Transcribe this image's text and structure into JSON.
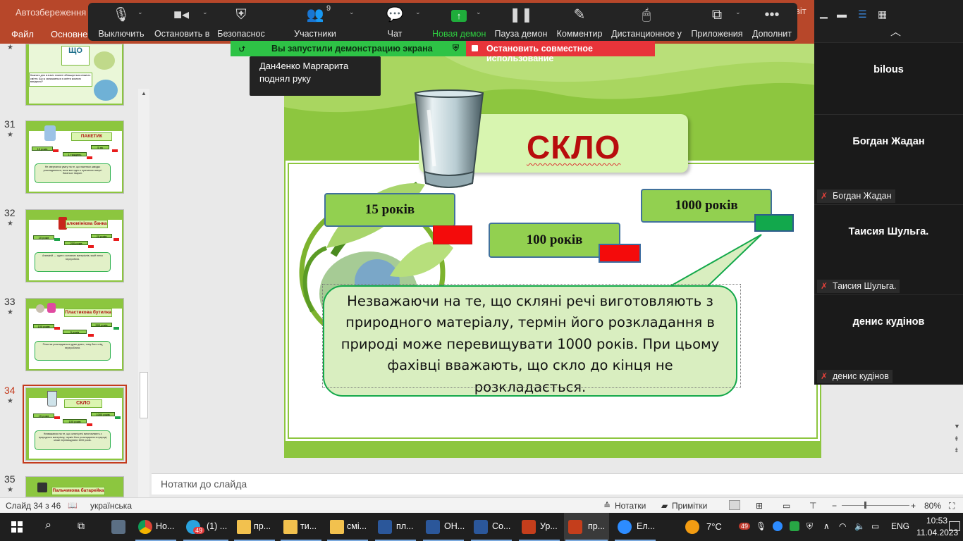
{
  "ppt": {
    "autosave": "Автозбереження",
    "title_tail": "віт",
    "tabs": [
      "Файл",
      "Основне"
    ]
  },
  "zoom": {
    "buttons": [
      {
        "label": "Выключить",
        "icon": "microphone-icon"
      },
      {
        "label": "Остановить в",
        "icon": "video-camera-icon"
      },
      {
        "label": "Безопаснос",
        "icon": "shield-icon"
      },
      {
        "label": "Участники",
        "icon": "participants-icon",
        "count": "9"
      },
      {
        "label": "Чат",
        "icon": "chat-icon"
      },
      {
        "label": "Новая демон",
        "icon": "share-screen-icon"
      },
      {
        "label": "Пауза демон",
        "icon": "pause-icon"
      },
      {
        "label": "Комментир",
        "icon": "pencil-icon"
      },
      {
        "label": "Дистанционное у",
        "icon": "mouse-icon"
      },
      {
        "label": "Приложения",
        "icon": "apps-icon"
      },
      {
        "label": "Дополнит",
        "icon": "more-icon"
      }
    ],
    "share_banner": "Вы запустили демонстрацию экрана",
    "stop_share": "Остановить совместное использование",
    "hand_toast": "Дан4енко Маргарита поднял руку",
    "participants": [
      {
        "name": "bilous",
        "tag": "bilous"
      },
      {
        "name": "Богдан Жадан",
        "tag": "Богдан Жадан"
      },
      {
        "name": "Таисия Шульга.",
        "tag": "Таисия Шульга."
      },
      {
        "name": "денис кудінов",
        "tag": "денис кудінов"
      }
    ]
  },
  "thumbnails": [
    {
      "num": "",
      "title": "ЩО",
      "caption": "Кожного дня в в всіх планеті збільшується кількість сміття. Що ж залишається з сміття кожного вихідного?"
    },
    {
      "num": "31",
      "title": "ПАКЕТИК",
      "boxes": [
        "10 років",
        "1 тиждень",
        "5 хв"
      ],
      "caption": "Не звертаючи увагу на те, що пакетики швидко розкладаються, вони все одно є причиною смерті багатьох тварин."
    },
    {
      "num": "32",
      "title": "алюмінієва банка",
      "boxes": [
        "10 років",
        "200 років",
        "20 років"
      ],
      "caption": "Алюміній — один з основних матеріалів, який легко переробити."
    },
    {
      "num": "33",
      "title": "Пластикова бутилка",
      "boxes": [
        "100 років",
        "5 років",
        "500 років"
      ],
      "caption": "Пластик розкладається дуже довго, тому його слід переробляти."
    },
    {
      "num": "34",
      "title": "СКЛО",
      "boxes": [
        "15 років",
        "100 років",
        "1000 років"
      ],
      "caption": "Незважаючи на те, що скляні речі виготовляють з природного матеріалу, термін його розкладання в природі може перевищувати 1000 років."
    },
    {
      "num": "35",
      "title": "Пальчикова батарейка"
    }
  ],
  "slide": {
    "title": "СКЛО",
    "years": [
      "15 років",
      "100 років",
      "1000 років"
    ],
    "bubble_text": "Незважаючи на те, що скляні речі виготовляють з природного матеріалу, термін його розкладання в природі може перевищувати 1000 років. При цьому фахівці вважають, що скло до кінця не розкладається."
  },
  "notes_placeholder": "Нотатки до слайда",
  "status": {
    "slide": "Слайд 34 з 46",
    "language": "українська",
    "notes": "Нотатки",
    "comments": "Примітки",
    "zoom": "80%"
  },
  "taskbar": {
    "items": [
      {
        "label": "Но...",
        "icon": "chrome-icon"
      },
      {
        "label": "(1) ...",
        "icon": "telegram-icon",
        "badge": "49"
      },
      {
        "label": "пр...",
        "icon": "folder-icon"
      },
      {
        "label": "ти...",
        "icon": "folder-icon"
      },
      {
        "label": "смі...",
        "icon": "folder-icon"
      },
      {
        "label": "пл...",
        "icon": "word-icon"
      },
      {
        "label": "ОН...",
        "icon": "word-icon"
      },
      {
        "label": "Со...",
        "icon": "word-icon"
      },
      {
        "label": "Ур...",
        "icon": "powerpoint-icon"
      },
      {
        "label": "пр...",
        "icon": "powerpoint-icon"
      },
      {
        "label": "Ел...",
        "icon": "zoom-icon"
      }
    ],
    "weather": "7°C",
    "tray_badge": "49",
    "lang": "ENG",
    "time": "10:53",
    "date": "11.04.2023"
  },
  "colors": {
    "ppt_red": "#b7472a",
    "slide_green": "#8dc63f",
    "title_red": "#b80d0d",
    "zoom_green": "#2ecc40",
    "stop_red": "#e8343a"
  }
}
